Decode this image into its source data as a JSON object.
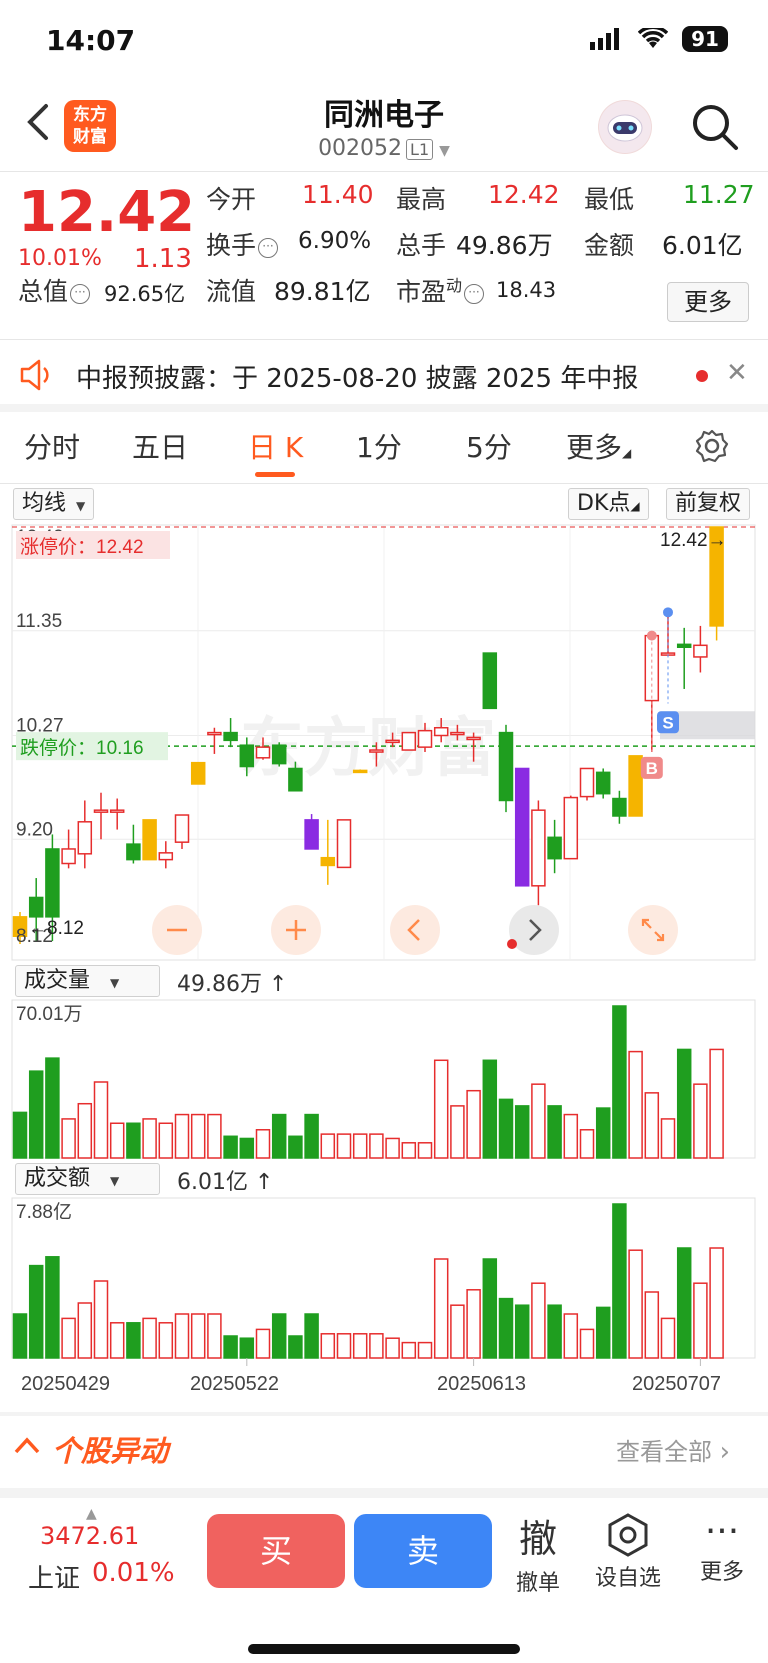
{
  "status": {
    "time": "14:07",
    "battery": "91"
  },
  "header": {
    "logo_line1": "东方",
    "logo_line2": "财富",
    "title": "同洲电子",
    "code": "002052",
    "level": "L1"
  },
  "quote": {
    "price": "12.42",
    "change_pct": "10.01%",
    "change": "1.13",
    "open_label": "今开",
    "open": "11.40",
    "high_label": "最高",
    "high": "12.42",
    "low_label": "最低",
    "low": "11.27",
    "turnover_label": "换手",
    "turnover": "6.90%",
    "volume_label": "总手",
    "volume": "49.86万",
    "amount_label": "金额",
    "amount": "6.01亿",
    "mktcap_label": "总值",
    "mktcap": "92.65亿",
    "float_label": "流值",
    "float_cap": "89.81亿",
    "pe_label": "市盈",
    "pe_sup": "动",
    "pe": "18.43",
    "more": "更多"
  },
  "notice": {
    "text": "中报预披露：于 2025-08-20 披露 2025 年中报",
    "close": "✕"
  },
  "tabs": {
    "items": [
      "分时",
      "五日",
      "日 K",
      "1分",
      "5分",
      "更多"
    ],
    "active": 2
  },
  "toolbar": {
    "ma": "均线",
    "dk": "DK点",
    "adjust": "前复权"
  },
  "kline": {
    "limit_up_label": "涨停价：12.42",
    "limit_down_label": "跌停价：10.16",
    "y_labels": [
      "12.42",
      "11.35",
      "10.27",
      "9.20",
      "8.12"
    ],
    "last_price_mark": "12.42",
    "low_mark": "8.12",
    "signals": [
      "S",
      "B"
    ]
  },
  "volume_panel": {
    "selector": "成交量",
    "value": "49.86万",
    "max_label": "70.01万"
  },
  "amount_panel": {
    "selector": "成交额",
    "value": "6.01亿",
    "max_label": "7.88亿"
  },
  "x_dates": [
    "20250429",
    "20250522",
    "20250613",
    "20250707"
  ],
  "movers": {
    "title": "个股异动",
    "view_all": "查看全部"
  },
  "bottom": {
    "index_value": "3472.61",
    "index_name": "上证",
    "index_pct": "0.01%",
    "buy": "买",
    "sell": "卖",
    "cancel_icon": "撤",
    "cancel": "撤单",
    "watch": "设自选",
    "more": "更多"
  },
  "colors": {
    "up": "#e62d2d",
    "down": "#1f9e1f",
    "accent": "#ff5a1f",
    "buy": "#f0625f",
    "sell": "#3d86f6"
  },
  "chart_data": {
    "type": "candlestick",
    "y_range": [
      8.12,
      12.42
    ],
    "candles": [
      {
        "o": 8.4,
        "h": 8.45,
        "l": 8.12,
        "c": 8.2
      },
      {
        "o": 8.6,
        "h": 8.8,
        "l": 8.15,
        "c": 8.4
      },
      {
        "o": 9.1,
        "h": 9.25,
        "l": 8.15,
        "c": 8.4
      },
      {
        "o": 8.95,
        "h": 9.3,
        "l": 8.9,
        "c": 9.1
      },
      {
        "o": 9.05,
        "h": 9.6,
        "l": 8.9,
        "c": 9.38
      },
      {
        "o": 9.5,
        "h": 9.68,
        "l": 9.2,
        "c": 9.5
      },
      {
        "o": 9.5,
        "h": 9.62,
        "l": 9.3,
        "c": 9.5
      },
      {
        "o": 9.15,
        "h": 9.35,
        "l": 8.95,
        "c": 8.99
      },
      {
        "o": 8.99,
        "h": 9.4,
        "l": 8.99,
        "c": 9.4
      },
      {
        "o": 8.99,
        "h": 9.18,
        "l": 8.9,
        "c": 9.06
      },
      {
        "o": 9.17,
        "h": 9.45,
        "l": 9.1,
        "c": 9.45
      },
      {
        "o": 9.77,
        "h": 9.9,
        "l": 9.77,
        "c": 9.99
      },
      {
        "o": 10.3,
        "h": 10.35,
        "l": 10.08,
        "c": 10.3
      },
      {
        "o": 10.3,
        "h": 10.45,
        "l": 10.15,
        "c": 10.22
      },
      {
        "o": 10.17,
        "h": 10.25,
        "l": 9.85,
        "c": 9.95
      },
      {
        "o": 10.04,
        "h": 10.25,
        "l": 10.02,
        "c": 10.15
      },
      {
        "o": 10.17,
        "h": 10.2,
        "l": 9.95,
        "c": 9.98
      },
      {
        "o": 9.93,
        "h": 10.0,
        "l": 9.7,
        "c": 9.7
      },
      {
        "o": 9.4,
        "h": 9.46,
        "l": 9.1,
        "c": 9.1
      },
      {
        "o": 8.93,
        "h": 9.4,
        "l": 8.73,
        "c": 9.01
      },
      {
        "o": 8.91,
        "h": 9.4,
        "l": 8.91,
        "c": 9.4
      },
      {
        "o": 9.91,
        "h": 9.92,
        "l": 9.91,
        "c": 9.91
      },
      {
        "o": 10.12,
        "h": 10.2,
        "l": 9.95,
        "c": 10.12
      },
      {
        "o": 10.22,
        "h": 10.3,
        "l": 10.15,
        "c": 10.22
      },
      {
        "o": 10.12,
        "h": 10.3,
        "l": 10.12,
        "c": 10.3
      },
      {
        "o": 10.15,
        "h": 10.4,
        "l": 10.1,
        "c": 10.32
      },
      {
        "o": 10.27,
        "h": 10.45,
        "l": 10.2,
        "c": 10.35
      },
      {
        "o": 10.3,
        "h": 10.38,
        "l": 10.22,
        "c": 10.3
      },
      {
        "o": 10.25,
        "h": 10.3,
        "l": 10.0,
        "c": 10.25
      },
      {
        "o": 11.12,
        "h": 11.12,
        "l": 10.6,
        "c": 10.55
      },
      {
        "o": 10.3,
        "h": 10.38,
        "l": 9.48,
        "c": 9.6
      },
      {
        "o": 9.93,
        "h": 9.93,
        "l": 8.72,
        "c": 8.72
      },
      {
        "o": 8.72,
        "h": 9.6,
        "l": 8.52,
        "c": 9.5
      },
      {
        "o": 9.22,
        "h": 9.4,
        "l": 8.85,
        "c": 9.0
      },
      {
        "o": 9.0,
        "h": 9.65,
        "l": 9.0,
        "c": 9.63
      },
      {
        "o": 9.64,
        "h": 9.93,
        "l": 9.6,
        "c": 9.93
      },
      {
        "o": 9.89,
        "h": 9.93,
        "l": 9.62,
        "c": 9.67
      },
      {
        "o": 9.62,
        "h": 9.7,
        "l": 9.36,
        "c": 9.44
      },
      {
        "o": 9.44,
        "h": 10.06,
        "l": 9.44,
        "c": 10.06
      },
      {
        "o": 10.63,
        "h": 11.3,
        "l": 10.1,
        "c": 11.3
      },
      {
        "o": 11.12,
        "h": 11.54,
        "l": 11.12,
        "c": 11.12
      },
      {
        "o": 11.21,
        "h": 11.38,
        "l": 10.75,
        "c": 11.18
      },
      {
        "o": 11.08,
        "h": 11.4,
        "l": 10.92,
        "c": 11.2
      },
      {
        "o": 11.4,
        "h": 12.42,
        "l": 11.25,
        "c": 12.42
      }
    ],
    "volume": [
      0.21,
      0.4,
      0.46,
      0.18,
      0.25,
      0.35,
      0.16,
      0.16,
      0.18,
      0.16,
      0.2,
      0.2,
      0.2,
      0.1,
      0.09,
      0.13,
      0.2,
      0.1,
      0.2,
      0.11,
      0.11,
      0.11,
      0.11,
      0.09,
      0.07,
      0.07,
      0.45,
      0.24,
      0.31,
      0.45,
      0.27,
      0.24,
      0.34,
      0.24,
      0.2,
      0.13,
      0.23,
      0.7,
      0.49,
      0.3,
      0.18,
      0.5,
      0.34,
      0.5
    ],
    "amount": [
      0.2,
      0.42,
      0.46,
      0.18,
      0.25,
      0.35,
      0.16,
      0.16,
      0.18,
      0.16,
      0.2,
      0.2,
      0.2,
      0.1,
      0.09,
      0.13,
      0.2,
      0.1,
      0.2,
      0.11,
      0.11,
      0.11,
      0.11,
      0.09,
      0.07,
      0.07,
      0.45,
      0.24,
      0.31,
      0.45,
      0.27,
      0.24,
      0.34,
      0.24,
      0.2,
      0.13,
      0.23,
      0.7,
      0.49,
      0.3,
      0.18,
      0.5,
      0.34,
      0.5
    ]
  }
}
